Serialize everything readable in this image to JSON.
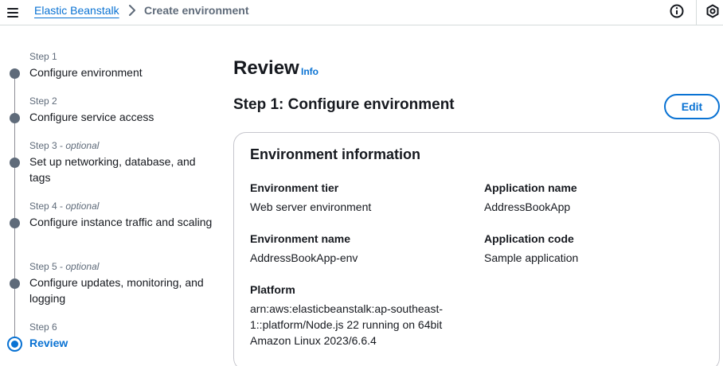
{
  "breadcrumb": {
    "service": "Elastic Beanstalk",
    "current": "Create environment"
  },
  "icons": {
    "menu": "hamburger-menu-icon",
    "separator": "chevron-right-icon",
    "info": "info-circle-icon",
    "settings": "hexagon-settings-icon"
  },
  "colors": {
    "link": "#0972d3",
    "text": "#16191f",
    "muted": "#5f6b7a",
    "border": "#c6c6cd"
  },
  "wizard": {
    "steps": [
      {
        "number": "Step 1",
        "optional": "",
        "title": "Configure environment",
        "active": false
      },
      {
        "number": "Step 2",
        "optional": "",
        "title": "Configure service access",
        "active": false
      },
      {
        "number": "Step 3",
        "optional": "optional",
        "title": "Set up networking, database, and tags",
        "active": false
      },
      {
        "number": "Step 4",
        "optional": "optional",
        "title": "Configure instance traffic and scaling",
        "active": false
      },
      {
        "number": "Step 5",
        "optional": "optional",
        "title": "Configure updates, monitoring, and logging",
        "active": false
      },
      {
        "number": "Step 6",
        "optional": "",
        "title": "Review",
        "active": true
      }
    ]
  },
  "main": {
    "title": "Review",
    "info_link": "Info",
    "step_heading": "Step 1: Configure environment",
    "edit_label": "Edit",
    "panel": {
      "title": "Environment information",
      "fields": {
        "environment_tier": {
          "label": "Environment tier",
          "value": "Web server environment"
        },
        "application_name": {
          "label": "Application name",
          "value": "AddressBookApp"
        },
        "environment_name": {
          "label": "Environment name",
          "value": "AddressBookApp-env"
        },
        "application_code": {
          "label": "Application code",
          "value": "Sample application"
        },
        "platform": {
          "label": "Platform",
          "value": "arn:aws:elasticbeanstalk:ap-southeast-1::platform/Node.js 22 running on 64bit Amazon Linux 2023/6.6.4"
        }
      }
    }
  }
}
